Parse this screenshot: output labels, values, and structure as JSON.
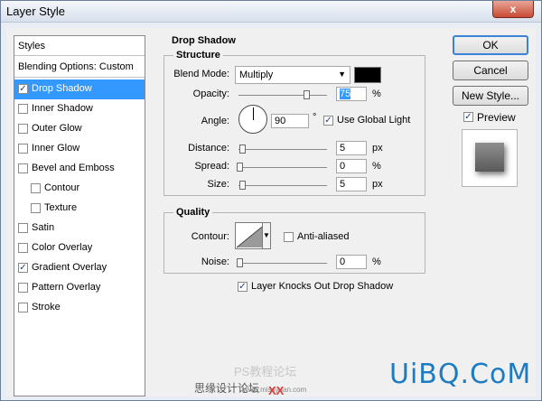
{
  "window": {
    "title": "Layer Style",
    "close_label": "x"
  },
  "styles": {
    "header": "Styles",
    "blending": "Blending Options: Custom",
    "items": [
      {
        "label": "Drop Shadow",
        "checked": true,
        "selected": true,
        "sub": false
      },
      {
        "label": "Inner Shadow",
        "checked": false,
        "selected": false,
        "sub": false
      },
      {
        "label": "Outer Glow",
        "checked": false,
        "selected": false,
        "sub": false
      },
      {
        "label": "Inner Glow",
        "checked": false,
        "selected": false,
        "sub": false
      },
      {
        "label": "Bevel and Emboss",
        "checked": false,
        "selected": false,
        "sub": false
      },
      {
        "label": "Contour",
        "checked": false,
        "selected": false,
        "sub": true
      },
      {
        "label": "Texture",
        "checked": false,
        "selected": false,
        "sub": true
      },
      {
        "label": "Satin",
        "checked": false,
        "selected": false,
        "sub": false
      },
      {
        "label": "Color Overlay",
        "checked": false,
        "selected": false,
        "sub": false
      },
      {
        "label": "Gradient Overlay",
        "checked": true,
        "selected": false,
        "sub": false
      },
      {
        "label": "Pattern Overlay",
        "checked": false,
        "selected": false,
        "sub": false
      },
      {
        "label": "Stroke",
        "checked": false,
        "selected": false,
        "sub": false
      }
    ]
  },
  "drop_shadow": {
    "title": "Drop Shadow",
    "structure": {
      "title": "Structure",
      "blend_mode_label": "Blend Mode:",
      "blend_mode_value": "Multiply",
      "opacity_label": "Opacity:",
      "opacity_value": "75",
      "opacity_unit": "%",
      "angle_label": "Angle:",
      "angle_value": "90",
      "angle_unit": "°",
      "use_global_light": "Use Global Light",
      "distance_label": "Distance:",
      "distance_value": "5",
      "distance_unit": "px",
      "spread_label": "Spread:",
      "spread_value": "0",
      "spread_unit": "%",
      "size_label": "Size:",
      "size_value": "5",
      "size_unit": "px",
      "shadow_color": "#000000"
    },
    "quality": {
      "title": "Quality",
      "contour_label": "Contour:",
      "anti_aliased": "Anti-aliased",
      "noise_label": "Noise:",
      "noise_value": "0",
      "noise_unit": "%"
    },
    "layer_knocks_out": "Layer Knocks Out Drop Shadow"
  },
  "buttons": {
    "ok": "OK",
    "cancel": "Cancel",
    "new_style": "New Style...",
    "preview": "Preview"
  },
  "watermarks": {
    "line1": "PS教程论坛",
    "line2": "思缘设计论坛",
    "line3": "www.missyuan.com",
    "line4": "XX",
    "logo": "UiBQ.CoM"
  }
}
